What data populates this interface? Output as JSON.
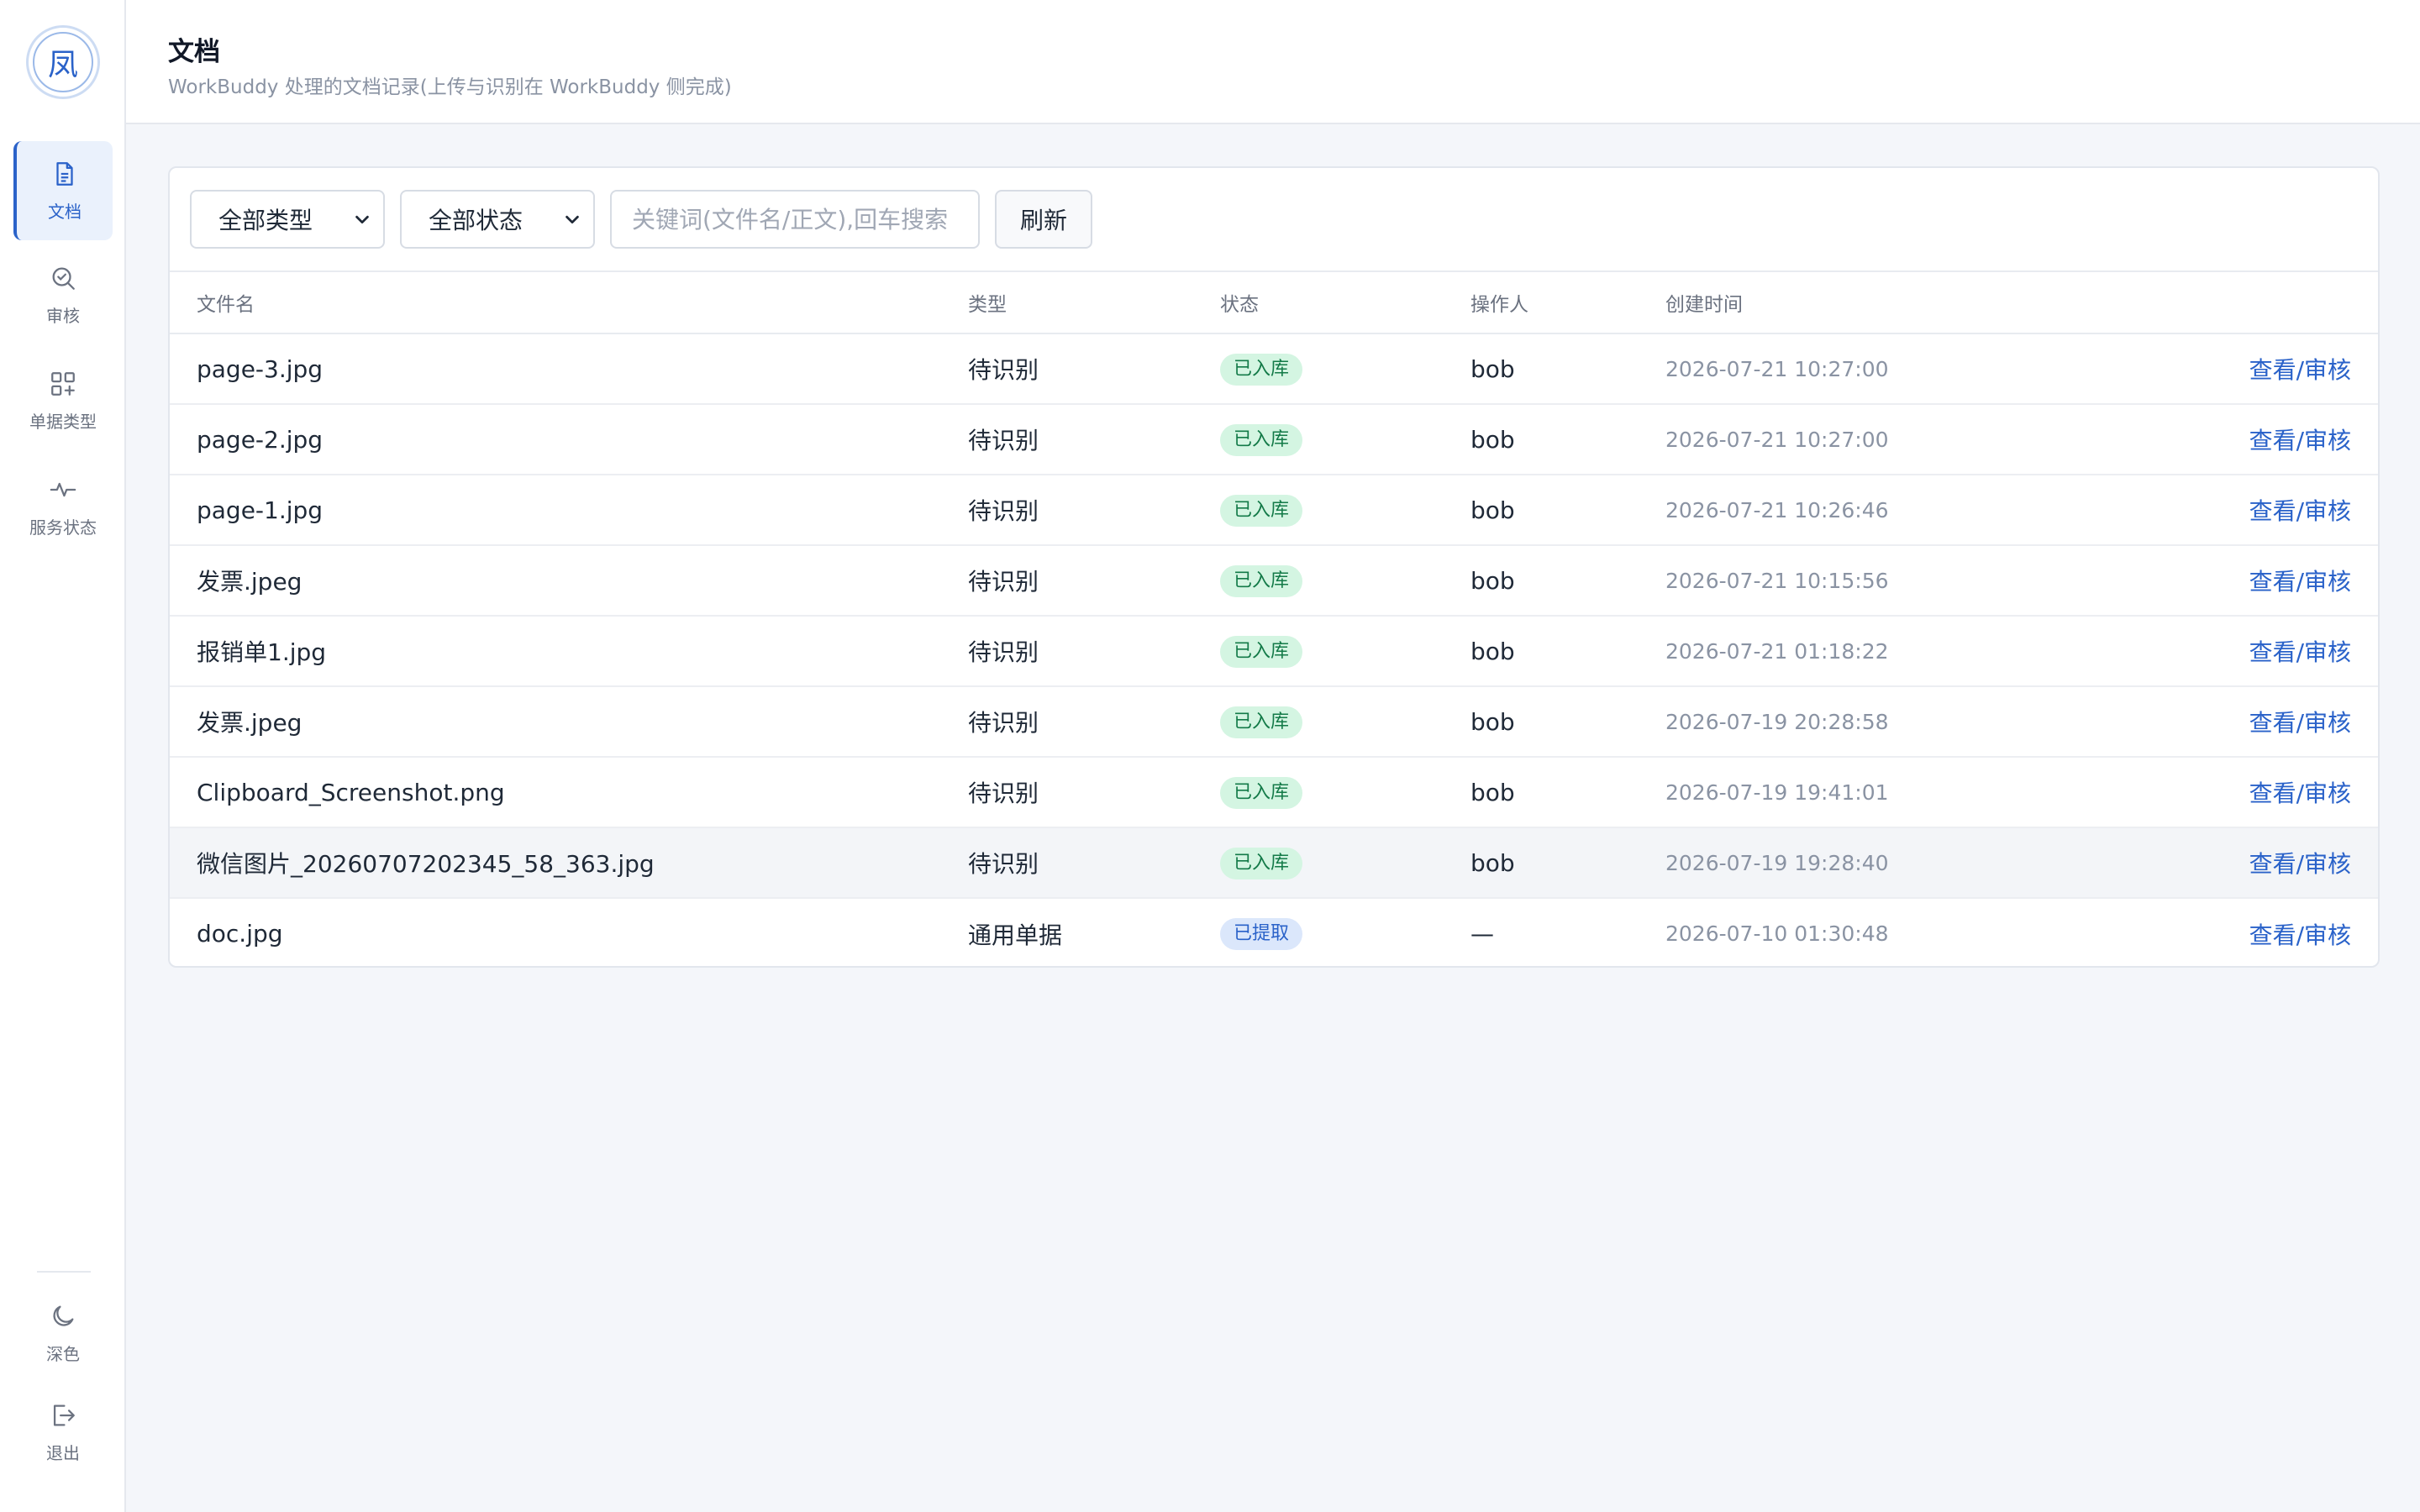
{
  "sidebar": {
    "logo_text": "凤",
    "nav": [
      {
        "label": "文档",
        "icon": "document-icon"
      },
      {
        "label": "审核",
        "icon": "review-icon"
      },
      {
        "label": "单据类型",
        "icon": "grid-add-icon"
      },
      {
        "label": "服务状态",
        "icon": "activity-icon"
      }
    ],
    "bottom": [
      {
        "label": "深色",
        "icon": "moon-icon"
      },
      {
        "label": "退出",
        "icon": "logout-icon"
      }
    ]
  },
  "header": {
    "title": "文档",
    "subtitle": "WorkBuddy 处理的文档记录(上传与识别在 WorkBuddy 侧完成)"
  },
  "toolbar": {
    "type_select": "全部类型",
    "status_select": "全部状态",
    "search_placeholder": "关键词(文件名/正文),回车搜索",
    "refresh_label": "刷新"
  },
  "table": {
    "columns": [
      "文件名",
      "类型",
      "状态",
      "操作人",
      "创建时间"
    ],
    "action_label": "查看/审核",
    "rows": [
      {
        "name": "page-3.jpg",
        "type": "待识别",
        "status": "已入库",
        "operator": "bob",
        "time": "2026-07-21 10:27:00"
      },
      {
        "name": "page-2.jpg",
        "type": "待识别",
        "status": "已入库",
        "operator": "bob",
        "time": "2026-07-21 10:27:00"
      },
      {
        "name": "page-1.jpg",
        "type": "待识别",
        "status": "已入库",
        "operator": "bob",
        "time": "2026-07-21 10:26:46"
      },
      {
        "name": "发票.jpeg",
        "type": "待识别",
        "status": "已入库",
        "operator": "bob",
        "time": "2026-07-21 10:15:56"
      },
      {
        "name": "报销单1.jpg",
        "type": "待识别",
        "status": "已入库",
        "operator": "bob",
        "time": "2026-07-21 01:18:22"
      },
      {
        "name": "发票.jpeg",
        "type": "待识别",
        "status": "已入库",
        "operator": "bob",
        "time": "2026-07-19 20:28:58"
      },
      {
        "name": "Clipboard_Screenshot.png",
        "type": "待识别",
        "status": "已入库",
        "operator": "bob",
        "time": "2026-07-19 19:41:01"
      },
      {
        "name": "微信图片_20260707202345_58_363.jpg",
        "type": "待识别",
        "status": "已入库",
        "operator": "bob",
        "time": "2026-07-19 19:28:40"
      },
      {
        "name": "doc.jpg",
        "type": "通用单据",
        "status": "已提取",
        "operator": "—",
        "time": "2026-07-10 01:30:48"
      }
    ]
  },
  "colors": {
    "accent": "#2a62c9",
    "badge_green_bg": "#d4f5e2",
    "badge_blue_bg": "#dbe7fb"
  }
}
